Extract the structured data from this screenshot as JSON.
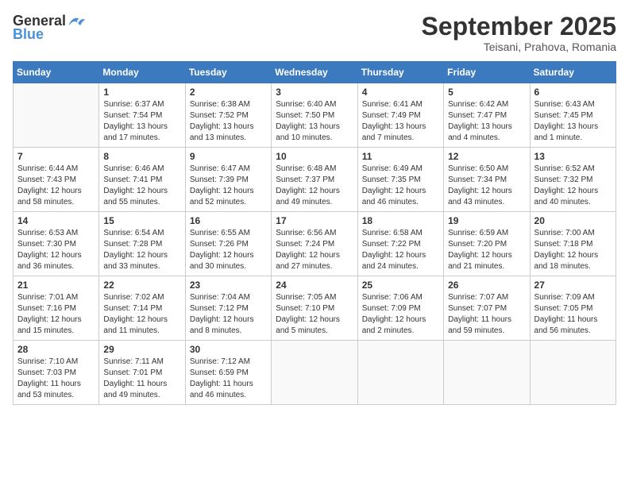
{
  "logo": {
    "text_general": "General",
    "text_blue": "Blue"
  },
  "title": "September 2025",
  "subtitle": "Teisani, Prahova, Romania",
  "days_of_week": [
    "Sunday",
    "Monday",
    "Tuesday",
    "Wednesday",
    "Thursday",
    "Friday",
    "Saturday"
  ],
  "weeks": [
    [
      {
        "day": "",
        "info": ""
      },
      {
        "day": "1",
        "info": "Sunrise: 6:37 AM\nSunset: 7:54 PM\nDaylight: 13 hours\nand 17 minutes."
      },
      {
        "day": "2",
        "info": "Sunrise: 6:38 AM\nSunset: 7:52 PM\nDaylight: 13 hours\nand 13 minutes."
      },
      {
        "day": "3",
        "info": "Sunrise: 6:40 AM\nSunset: 7:50 PM\nDaylight: 13 hours\nand 10 minutes."
      },
      {
        "day": "4",
        "info": "Sunrise: 6:41 AM\nSunset: 7:49 PM\nDaylight: 13 hours\nand 7 minutes."
      },
      {
        "day": "5",
        "info": "Sunrise: 6:42 AM\nSunset: 7:47 PM\nDaylight: 13 hours\nand 4 minutes."
      },
      {
        "day": "6",
        "info": "Sunrise: 6:43 AM\nSunset: 7:45 PM\nDaylight: 13 hours\nand 1 minute."
      }
    ],
    [
      {
        "day": "7",
        "info": "Sunrise: 6:44 AM\nSunset: 7:43 PM\nDaylight: 12 hours\nand 58 minutes."
      },
      {
        "day": "8",
        "info": "Sunrise: 6:46 AM\nSunset: 7:41 PM\nDaylight: 12 hours\nand 55 minutes."
      },
      {
        "day": "9",
        "info": "Sunrise: 6:47 AM\nSunset: 7:39 PM\nDaylight: 12 hours\nand 52 minutes."
      },
      {
        "day": "10",
        "info": "Sunrise: 6:48 AM\nSunset: 7:37 PM\nDaylight: 12 hours\nand 49 minutes."
      },
      {
        "day": "11",
        "info": "Sunrise: 6:49 AM\nSunset: 7:35 PM\nDaylight: 12 hours\nand 46 minutes."
      },
      {
        "day": "12",
        "info": "Sunrise: 6:50 AM\nSunset: 7:34 PM\nDaylight: 12 hours\nand 43 minutes."
      },
      {
        "day": "13",
        "info": "Sunrise: 6:52 AM\nSunset: 7:32 PM\nDaylight: 12 hours\nand 40 minutes."
      }
    ],
    [
      {
        "day": "14",
        "info": "Sunrise: 6:53 AM\nSunset: 7:30 PM\nDaylight: 12 hours\nand 36 minutes."
      },
      {
        "day": "15",
        "info": "Sunrise: 6:54 AM\nSunset: 7:28 PM\nDaylight: 12 hours\nand 33 minutes."
      },
      {
        "day": "16",
        "info": "Sunrise: 6:55 AM\nSunset: 7:26 PM\nDaylight: 12 hours\nand 30 minutes."
      },
      {
        "day": "17",
        "info": "Sunrise: 6:56 AM\nSunset: 7:24 PM\nDaylight: 12 hours\nand 27 minutes."
      },
      {
        "day": "18",
        "info": "Sunrise: 6:58 AM\nSunset: 7:22 PM\nDaylight: 12 hours\nand 24 minutes."
      },
      {
        "day": "19",
        "info": "Sunrise: 6:59 AM\nSunset: 7:20 PM\nDaylight: 12 hours\nand 21 minutes."
      },
      {
        "day": "20",
        "info": "Sunrise: 7:00 AM\nSunset: 7:18 PM\nDaylight: 12 hours\nand 18 minutes."
      }
    ],
    [
      {
        "day": "21",
        "info": "Sunrise: 7:01 AM\nSunset: 7:16 PM\nDaylight: 12 hours\nand 15 minutes."
      },
      {
        "day": "22",
        "info": "Sunrise: 7:02 AM\nSunset: 7:14 PM\nDaylight: 12 hours\nand 11 minutes."
      },
      {
        "day": "23",
        "info": "Sunrise: 7:04 AM\nSunset: 7:12 PM\nDaylight: 12 hours\nand 8 minutes."
      },
      {
        "day": "24",
        "info": "Sunrise: 7:05 AM\nSunset: 7:10 PM\nDaylight: 12 hours\nand 5 minutes."
      },
      {
        "day": "25",
        "info": "Sunrise: 7:06 AM\nSunset: 7:09 PM\nDaylight: 12 hours\nand 2 minutes."
      },
      {
        "day": "26",
        "info": "Sunrise: 7:07 AM\nSunset: 7:07 PM\nDaylight: 11 hours\nand 59 minutes."
      },
      {
        "day": "27",
        "info": "Sunrise: 7:09 AM\nSunset: 7:05 PM\nDaylight: 11 hours\nand 56 minutes."
      }
    ],
    [
      {
        "day": "28",
        "info": "Sunrise: 7:10 AM\nSunset: 7:03 PM\nDaylight: 11 hours\nand 53 minutes."
      },
      {
        "day": "29",
        "info": "Sunrise: 7:11 AM\nSunset: 7:01 PM\nDaylight: 11 hours\nand 49 minutes."
      },
      {
        "day": "30",
        "info": "Sunrise: 7:12 AM\nSunset: 6:59 PM\nDaylight: 11 hours\nand 46 minutes."
      },
      {
        "day": "",
        "info": ""
      },
      {
        "day": "",
        "info": ""
      },
      {
        "day": "",
        "info": ""
      },
      {
        "day": "",
        "info": ""
      }
    ]
  ]
}
